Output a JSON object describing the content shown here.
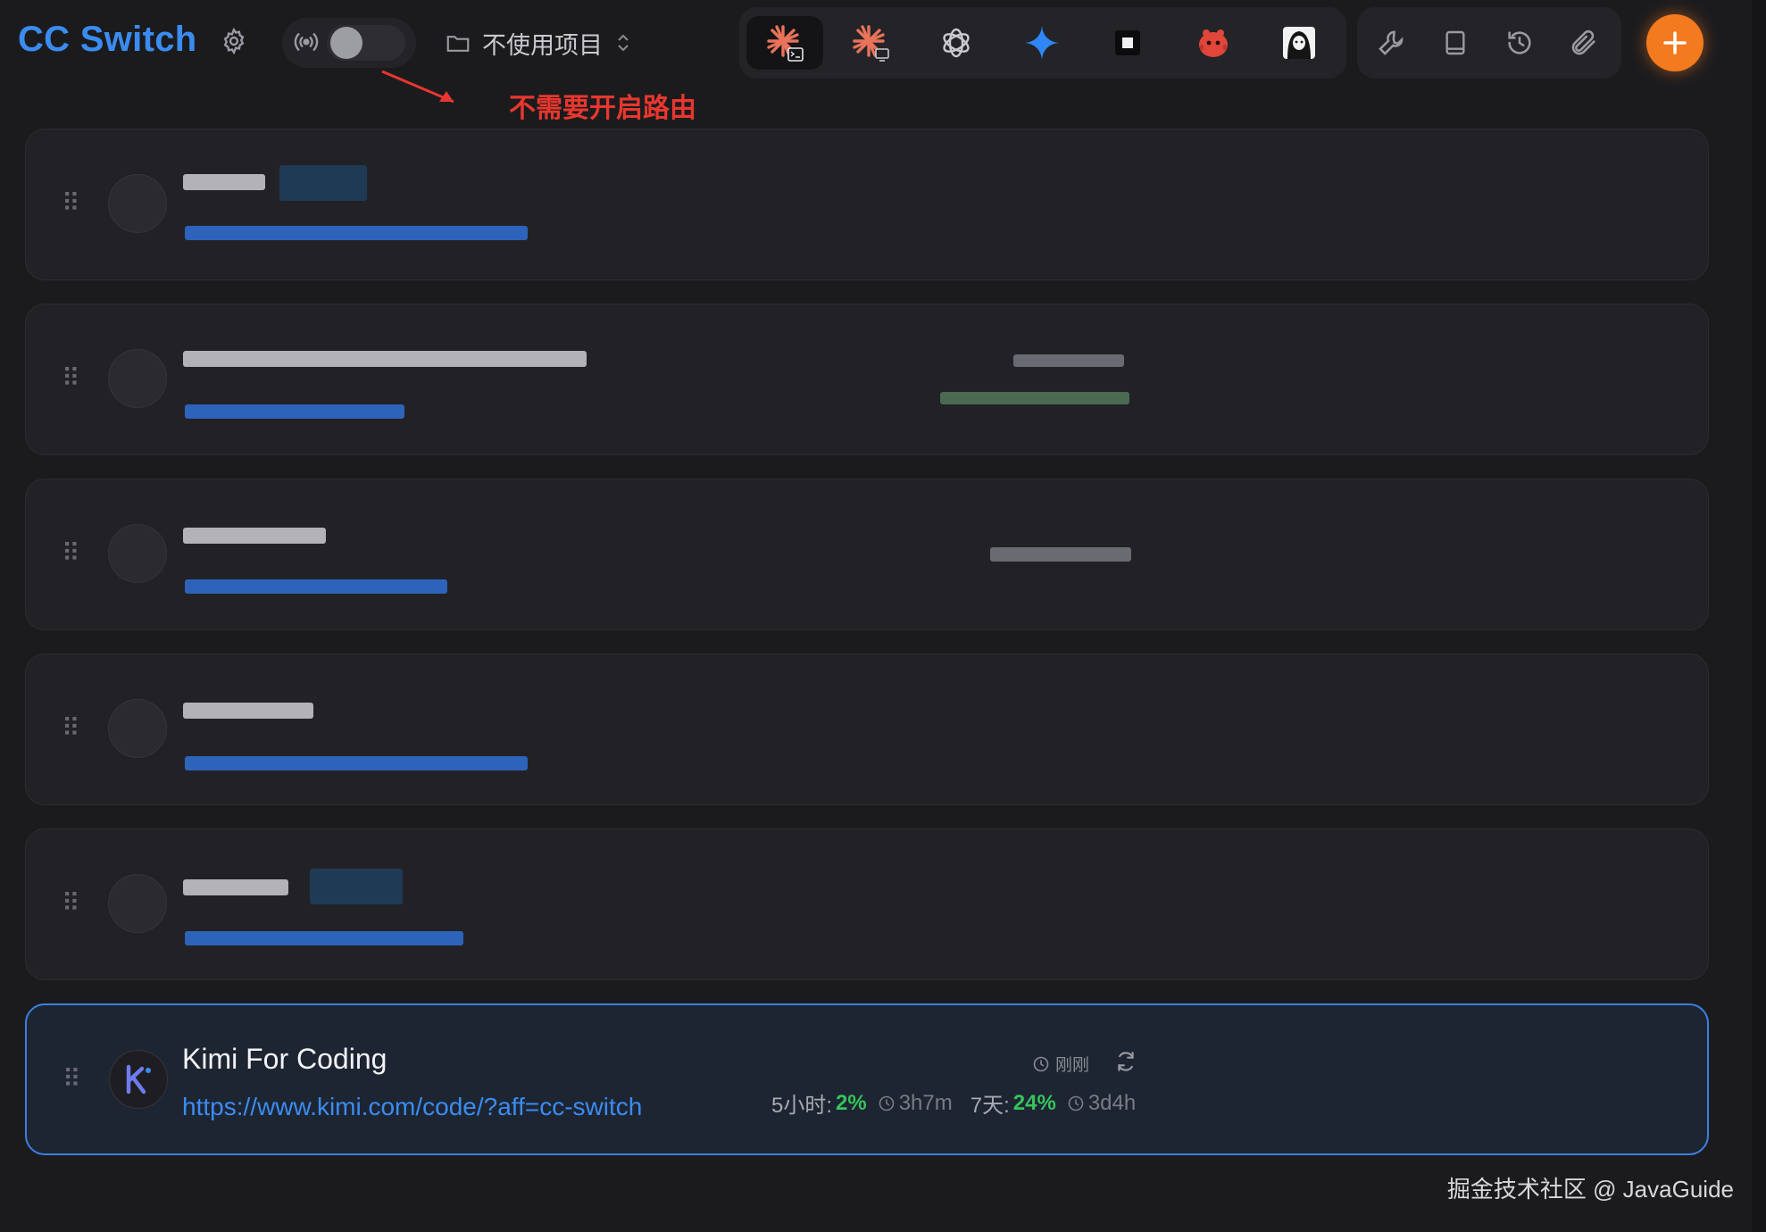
{
  "header": {
    "app_title": "CC Switch",
    "project_label": "不使用项目",
    "annotation": "不需要开启路由"
  },
  "apps": [
    {
      "name": "claude-code-icon",
      "active": true
    },
    {
      "name": "claude-desktop-icon",
      "active": false
    },
    {
      "name": "openai-icon",
      "active": false
    },
    {
      "name": "gemini-icon",
      "active": false
    },
    {
      "name": "terminal-icon",
      "active": false
    },
    {
      "name": "red-mascot-icon",
      "active": false
    },
    {
      "name": "avatar-app-icon",
      "active": false
    }
  ],
  "colors": {
    "accent": "#3b8cf0",
    "add_button": "#f47a1f",
    "percent_green": "#36c45a",
    "annotation_red": "#e8372e",
    "selected_border": "#3c7fe0"
  },
  "providers": {
    "selected": {
      "name": "Kimi For Coding",
      "url": "https://www.kimi.com/code/?aff=cc-switch",
      "updated": "刚刚",
      "window_5h_label": "5小时:",
      "window_5h_pct": "2%",
      "window_5h_reset": "3h7m",
      "window_7d_label": "7天:",
      "window_7d_pct": "24%",
      "window_7d_reset": "3d4h"
    }
  },
  "footer": {
    "watermark": "掘金技术社区 @ JavaGuide"
  }
}
